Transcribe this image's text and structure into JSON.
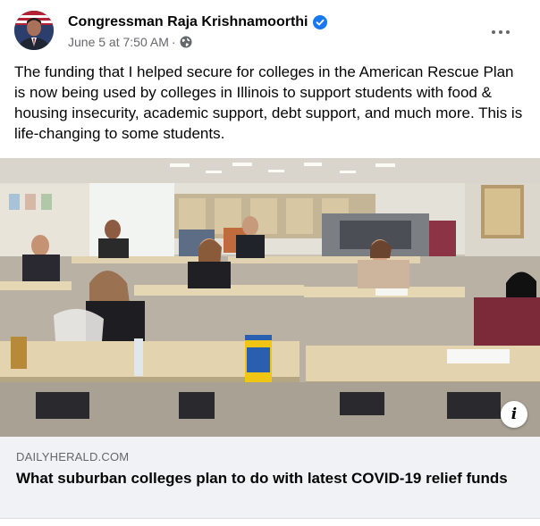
{
  "post": {
    "author": "Congressman Raja Krishnamoorthi",
    "date": "June 5 at 7:50 AM",
    "separator": "·",
    "text": "The funding that I helped secure for colleges in the American Rescue Plan is now being used by colleges in Illinois to support students with food & housing insecurity, academic support, debt support, and much more. This is life-changing to some students.",
    "icons": {
      "verified": "verified-badge-icon",
      "privacy": "globe-icon",
      "more": "more-options-icon",
      "info": "info-icon"
    }
  },
  "link": {
    "domain": "DAILYHERALD.COM",
    "title": "What suburban colleges plan to do with latest COVID-19 relief funds",
    "info_glyph": "i"
  },
  "colors": {
    "verified": "#1877f2",
    "secondary_text": "#65676b",
    "card_bg": "#f0f2f5"
  }
}
